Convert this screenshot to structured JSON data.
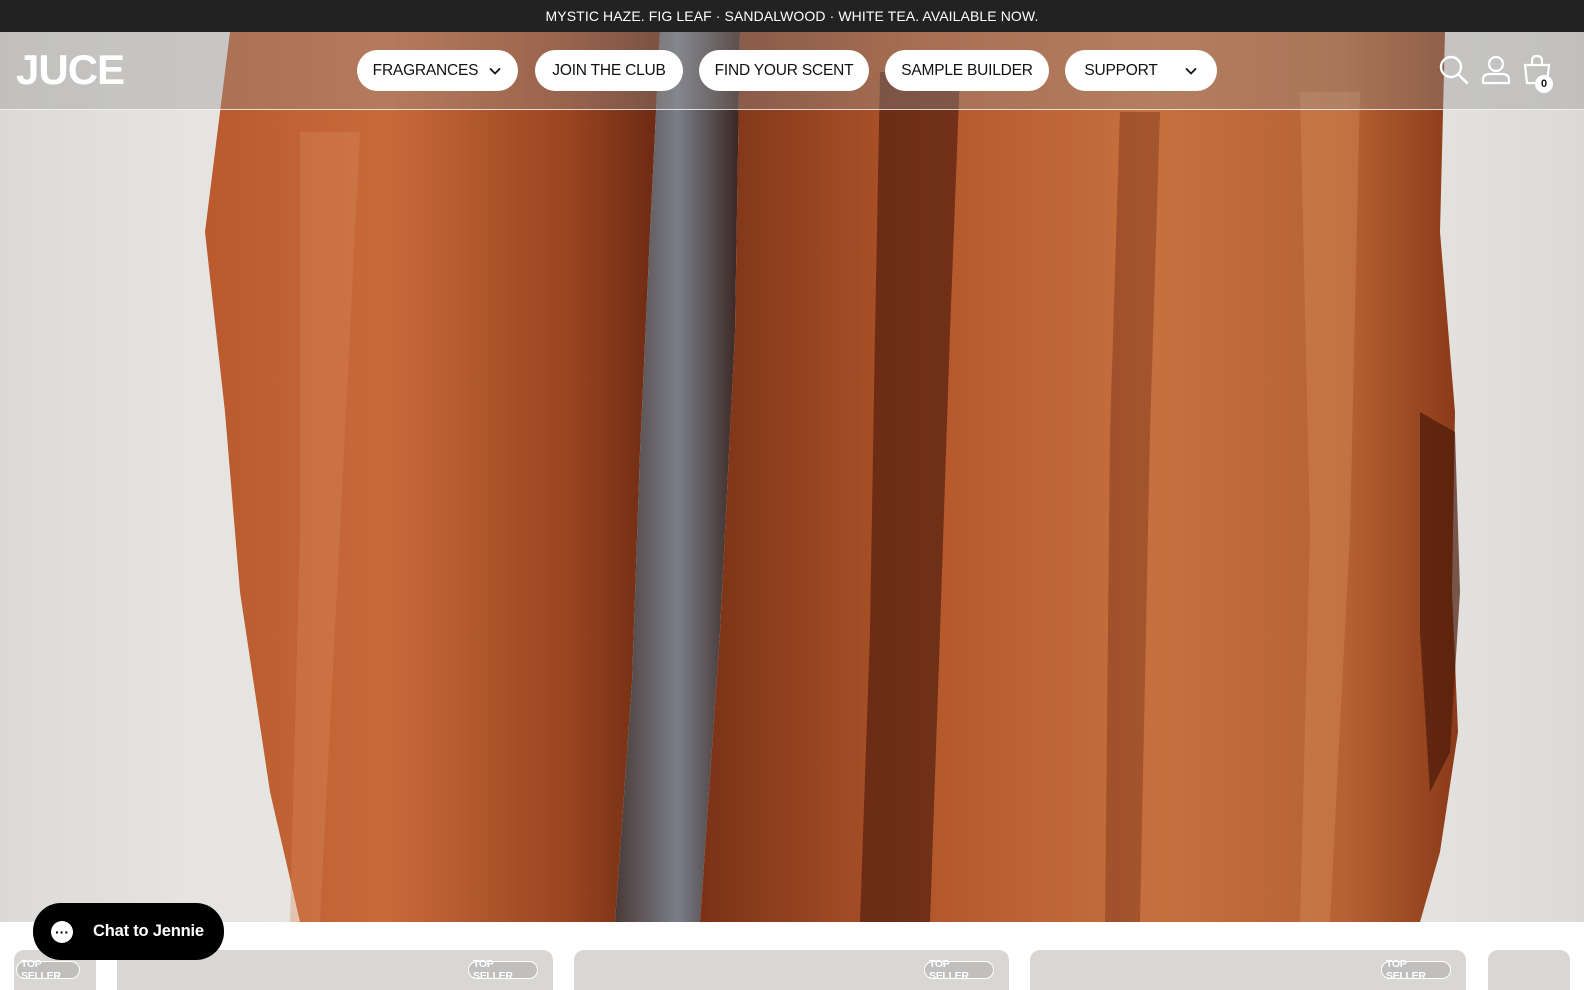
{
  "announcement": "MYSTIC HAZE. FIG LEAF · SANDALWOOD · WHITE TEA. AVAILABLE NOW.",
  "brand": {
    "logo": "JUCE"
  },
  "nav": {
    "fragrances": "FRAGRANCES",
    "join": "JOIN THE CLUB",
    "find": "FIND YOUR SCENT",
    "sample": "SAMPLE BUILDER",
    "support": "SUPPORT"
  },
  "header_icons": {
    "search": "search-icon",
    "account": "user-icon",
    "cart": "bag-icon"
  },
  "cart": {
    "count": "0"
  },
  "hero": {
    "image": "carved-wood-sculpture"
  },
  "products": {
    "badge": "TOP SELLER"
  },
  "chat": {
    "label": "Chat to Jennie",
    "icon": "chat-bubble-icon"
  }
}
